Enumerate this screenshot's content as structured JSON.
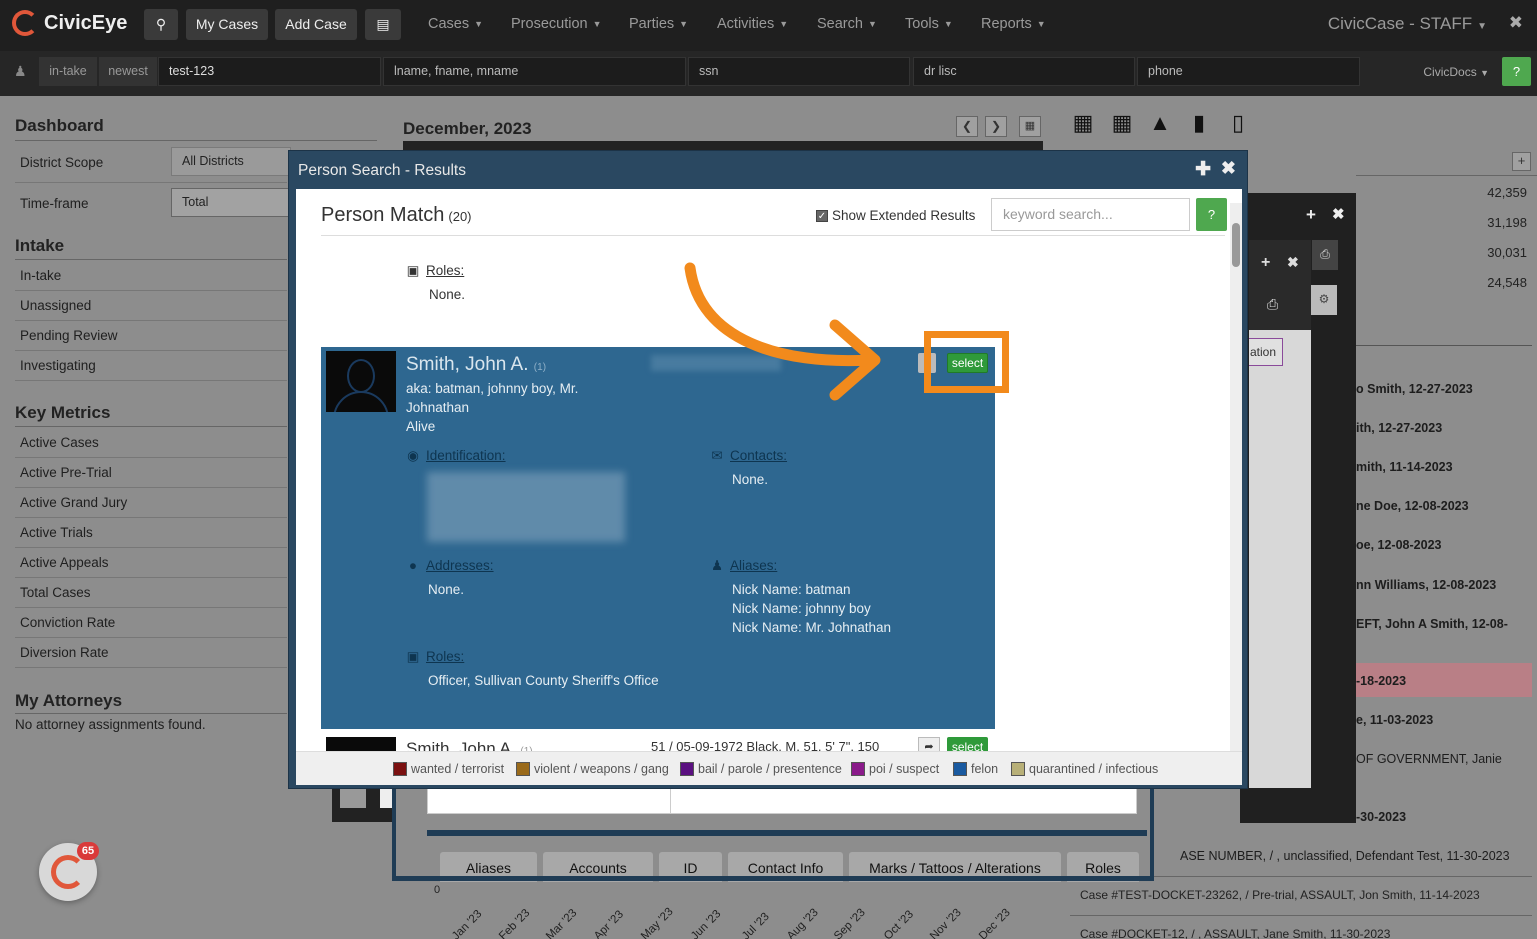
{
  "topnav": {
    "logo": "CivicEye",
    "my_cases": "My Cases",
    "add_case": "Add Case",
    "menus": [
      "Cases",
      "Prosecution",
      "Parties",
      "Activities",
      "Search",
      "Tools",
      "Reports"
    ],
    "brand": "CivicCase - STAFF"
  },
  "searchbar": {
    "intake": "in-take",
    "newest": "newest",
    "case_value": "test-123",
    "name_placeholder": "lname, fname, mname",
    "ssn_placeholder": "ssn",
    "drlisc_placeholder": "dr lisc",
    "phone_placeholder": "phone",
    "civicdocs": "CivicDocs",
    "help": "?"
  },
  "dashboard": {
    "title": "Dashboard",
    "district_scope_label": "District Scope",
    "district_scope_value": "All Districts",
    "timeframe_label": "Time-frame",
    "timeframe_value": "Total",
    "intake_title": "Intake",
    "intake_items": [
      "In-take",
      "Unassigned",
      "Pending Review",
      "Investigating"
    ],
    "metrics_title": "Key Metrics",
    "metrics_items": [
      "Active Cases",
      "Active Pre-Trial",
      "Active Grand Jury",
      "Active Trials",
      "Active Appeals",
      "Total Cases",
      "Conviction Rate",
      "Diversion Rate"
    ],
    "attorneys_title": "My Attorneys",
    "attorneys_empty": "No attorney assignments found."
  },
  "calendar": {
    "month": "December, 2023"
  },
  "right_panel": {
    "numbers": [
      "42,359",
      "31,198",
      "30,031",
      "24,548"
    ],
    "recent": [
      "o Smith, 12-27-2023",
      "ith, 12-27-2023",
      "mith, 11-14-2023",
      "ne Doe, 12-08-2023",
      "oe, 12-08-2023",
      "nn Williams, 12-08-2023",
      "EFT, John A Smith, 12-08-",
      "-18-2023",
      "e, 11-03-2023",
      "OF GOVERNMENT, Janie",
      "-30-2023",
      "ASE NUMBER, / , unclassified, Defendant Test, 11-30-2023",
      "Case #TEST-DOCKET-23262, / Pre-trial, ASSAULT, Jon Smith, 11-14-2023",
      "Case #DOCKET-12, / , ASSAULT, Jane Smith, 11-30-2023"
    ],
    "bg_button": "ation"
  },
  "modal": {
    "title": "Person Search - Results",
    "heading": "Person Match",
    "count": "(20)",
    "show_extended": "Show Extended Results",
    "keyword_placeholder": "keyword search...",
    "help": "?",
    "prev_roles_label": "Roles:",
    "prev_roles_value": "None.",
    "card": {
      "name": "Smith, John A.",
      "index": "(1)",
      "aka": "aka: batman, johnny boy, Mr.",
      "aka2": "Johnathan",
      "status": "Alive",
      "select": "select",
      "identification_label": "Identification:",
      "contacts_label": "Contacts:",
      "contacts_value": "None.",
      "addresses_label": "Addresses:",
      "addresses_value": "None.",
      "aliases_label": "Aliases:",
      "aliases": [
        "Nick Name: batman",
        "Nick Name: johnny boy",
        "Nick Name: Mr. Johnathan"
      ],
      "roles_label": "Roles:",
      "roles_value": "Officer, Sullivan County Sheriff's Office"
    },
    "row2": {
      "name": "Smith, John A.",
      "index": "(1)",
      "details": "51 / 05-09-1972   Black, M, 51, 5' 7\", 150",
      "select": "select"
    },
    "legend": [
      {
        "label": "wanted / terrorist",
        "color": "#7a1010"
      },
      {
        "label": "violent / weapons / gang",
        "color": "#9a6a1a"
      },
      {
        "label": "bail / parole / presentence",
        "color": "#5a1080"
      },
      {
        "label": "poi / suspect",
        "color": "#8a1a8a"
      },
      {
        "label": "felon",
        "color": "#1a5aa0"
      },
      {
        "label": "quarantined / infectious",
        "color": "#b8b078"
      }
    ]
  },
  "bottom_tabs": [
    "Aliases",
    "Accounts",
    "ID",
    "Contact Info",
    "Marks / Tattoos / Alterations",
    "Roles"
  ],
  "months": [
    "Jan '23",
    "Feb '23",
    "Mar '23",
    "Apr '23",
    "May '23",
    "Jun '23",
    "Jul '23",
    "Aug '23",
    "Sep '23",
    "Oct '23",
    "Nov '23",
    "Dec '23"
  ],
  "chat_badge": "65"
}
